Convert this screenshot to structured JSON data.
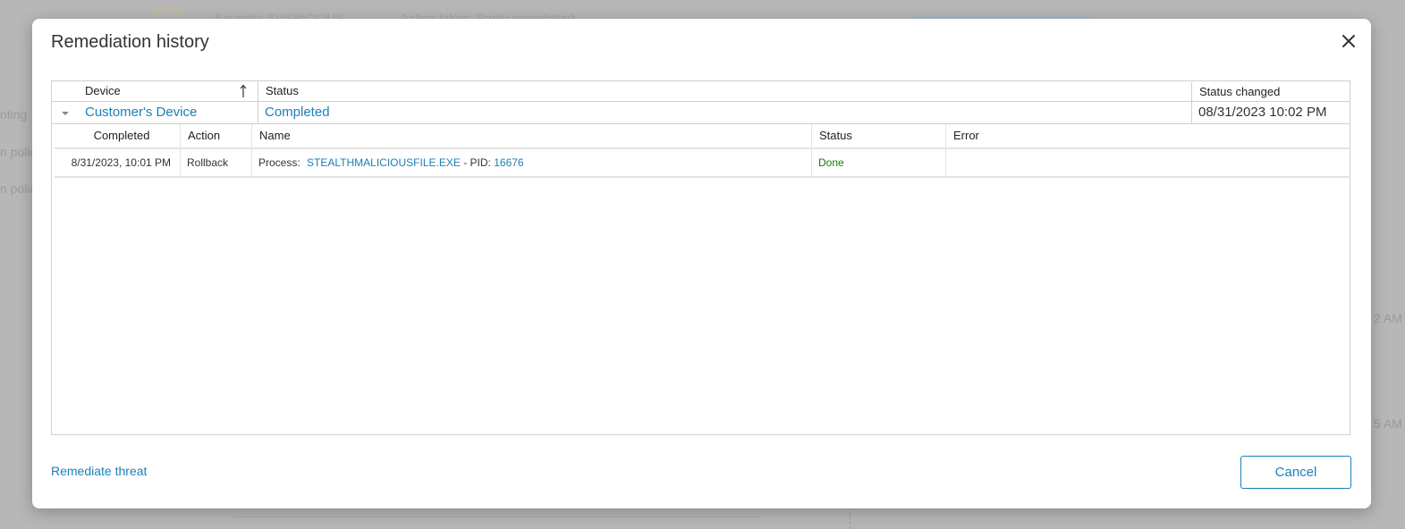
{
  "background": {
    "left_texts": [
      "nting",
      "n polic",
      "n polic"
    ],
    "top_texts": [
      "Severity: SUSPICIOUS",
      "Action taken: Partly remediated"
    ],
    "right_texts": [
      "2 AM",
      "5 AM"
    ]
  },
  "dialog": {
    "title": "Remediation history",
    "close_icon": "close-icon"
  },
  "grid": {
    "columns": [
      "Device",
      "Status",
      "Status changed"
    ],
    "sort_icon": "sort-ascending-icon",
    "device_row": {
      "device": "Customer's Device",
      "status": "Completed",
      "status_changed": "08/31/2023 10:02 PM",
      "expand_icon": "expand-caret-icon"
    },
    "sub_columns": [
      "Completed",
      "Action",
      "Name",
      "Status",
      "Error"
    ],
    "sub_rows": [
      {
        "completed": "8/31/2023, 10:01 PM",
        "action": "Rollback",
        "name_prefix": "Process:",
        "process": "STEALTHMALICIOUSFILE.EXE",
        "name_mid": "- PID:",
        "pid": "16676",
        "status": "Done",
        "error": ""
      }
    ]
  },
  "footer": {
    "remediate_link": "Remediate threat",
    "cancel_label": "Cancel"
  },
  "colors": {
    "accent": "#1a7fb6",
    "done": "#107c10"
  }
}
